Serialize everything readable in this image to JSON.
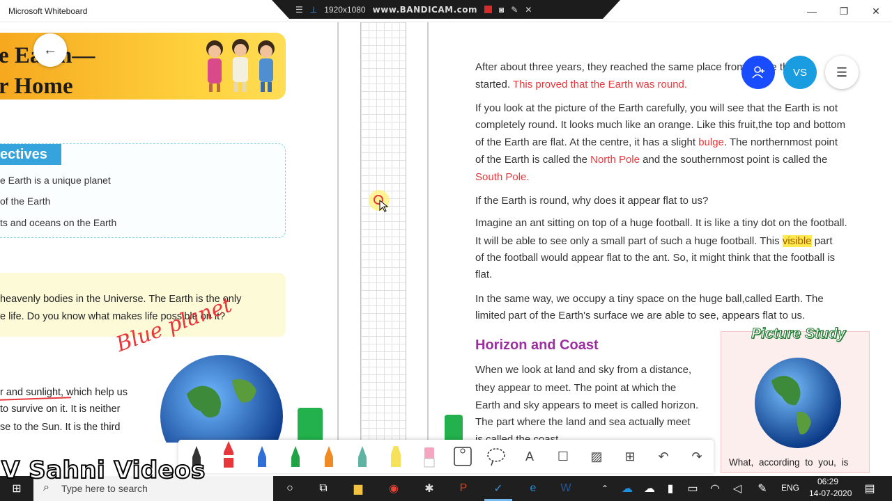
{
  "window": {
    "title": "Microsoft Whiteboard"
  },
  "recorder": {
    "resolution": "1920x1080",
    "brand": "www.BANDICAM.com"
  },
  "left_page": {
    "banner_title_line1": "e Earth—",
    "banner_title_line2": "r Home",
    "objectives_tab": "ectives",
    "objectives": [
      "e Earth is a unique planet",
      "of the Earth",
      "ts and oceans on the Earth"
    ],
    "intro_lines": [
      "heavenly bodies in the Universe. The Earth is the only",
      "e life. Do you know what makes life possible on it?"
    ],
    "annotation": "Blue planet",
    "body_lines": [
      "r and sunlight, which help us",
      "to survive on it. It is neither",
      "se to the Sun. It is the third"
    ]
  },
  "right_page": {
    "p1_line1": "After about three years, they reached the same place from where they",
    "p1_line2_a": "started. ",
    "p1_line2_b": "This proved that the Earth was round.",
    "p2_line1": "If you look at the picture of the Earth carefully, you will see that the Earth is not",
    "p2_line2": "completely round. It looks much like an orange. Like this fruit,the top and bottom",
    "p2_line3_a": "of the Earth are flat. At the centre, it has a slight ",
    "p2_line3_b": "bulge",
    "p2_line3_c": ". The northernmost point",
    "p2_line4_a": "of the Earth is called the ",
    "p2_line4_b": "North Pole",
    "p2_line4_c": " and the southernmost point is called the",
    "p2_line5": "South Pole.",
    "q1": "If the Earth is round, why does it appear flat to us?",
    "p3_line1": "Imagine an ant sitting on top of a huge football. It is like a tiny dot on the football.",
    "p3_line2_a": "It will be able to see only a small part of such a huge football. This ",
    "p3_line2_b": "visible",
    "p3_line2_c": " part",
    "p3_line3": "of the football would appear flat to the ant. So, it might think that the football is",
    "p3_line4": "flat.",
    "p4_line1": "In the same way, we occupy a tiny space on the huge ball,called Earth. The",
    "p4_line2": "limited part of the Earth's surface we are able to see, appears flat to us.",
    "heading": "Horizon and Coast",
    "p5_lines": [
      "When we look at land and sky from a distance,",
      "they appear to meet. The point at which the",
      "Earth and sky appears to meet is called horizon.",
      "The part where the land and sea actually meet",
      "is called the coast."
    ],
    "picture_study_title": "Picture Study",
    "picture_study_caption": "What, according to you, is"
  },
  "user_avatar": "VS",
  "watermark": "V Sahni Videos",
  "taskbar": {
    "search_placeholder": "Type here to search",
    "language": "ENG",
    "time": "06:29",
    "date": "14-07-2020"
  },
  "colors": {
    "accent_blue": "#1a4cff",
    "avatar_blue": "#1a9de0",
    "highlight_red": "#e8373a",
    "heading_purple": "#9b2fa0"
  }
}
